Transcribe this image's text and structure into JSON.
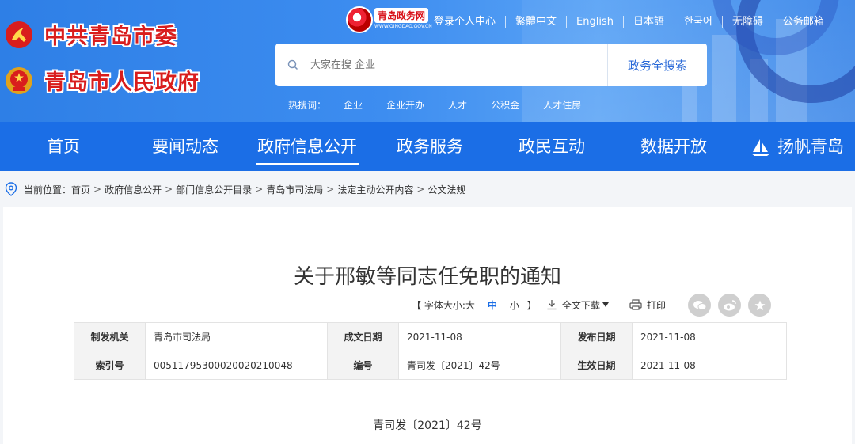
{
  "header": {
    "logo_party": "中共青岛市委",
    "logo_gov": "青岛市人民政府",
    "portal_title": "青岛政务网",
    "portal_domain": "WWW.QINGDAO.GOV.CN",
    "top_links": [
      "登录个人中心",
      "繁體中文",
      "English",
      "日本語",
      "한국어",
      "无障碍",
      "公务邮箱"
    ],
    "search": {
      "placeholder": "大家在搜 企业",
      "button": "政务全搜索"
    },
    "hot_label": "热搜词：",
    "hot_words": [
      "企业",
      "企业开办",
      "人才",
      "公积金",
      "人才住房"
    ]
  },
  "nav": {
    "items": [
      "首页",
      "要闻动态",
      "政府信息公开",
      "政务服务",
      "政民互动",
      "数据开放",
      "扬帆青岛"
    ],
    "active": "政府信息公开"
  },
  "breadcrumb": {
    "label": "当前位置：",
    "items": [
      "首页",
      "政府信息公开",
      "部门信息公开目录",
      "青岛市司法局",
      "法定主动公开内容",
      "公文法规"
    ]
  },
  "article": {
    "title": "关于邢敏等同志任免职的通知",
    "font_size_label": "【 字体大小: ",
    "sizes": [
      "大",
      "中",
      "小"
    ],
    "sizes_close": "】",
    "download": "全文下载",
    "print": "打印",
    "meta": [
      [
        {
          "k": "制发机关",
          "v": "青岛市司法局"
        },
        {
          "k": "成文日期",
          "v": "2021-11-08"
        },
        {
          "k": "发布日期",
          "v": "2021-11-08"
        }
      ],
      [
        {
          "k": "索引号",
          "v": "00511795300020020210048"
        },
        {
          "k": "编号",
          "v": "青司发〔2021〕42号"
        },
        {
          "k": "生效日期",
          "v": "2021-11-08"
        }
      ]
    ],
    "doc_number": "青司发〔2021〕42号"
  },
  "colors": {
    "nav_bg": "#1b6ee6",
    "logo_red": "#d91d1d",
    "accent_blue": "#1b6ee6"
  }
}
